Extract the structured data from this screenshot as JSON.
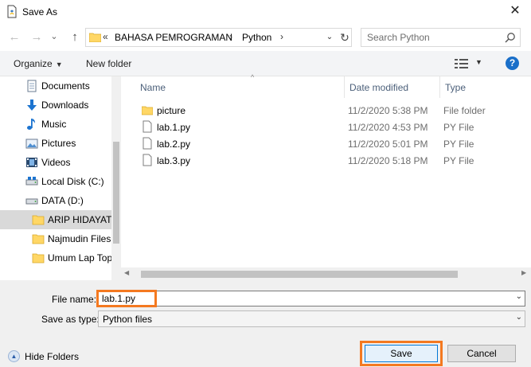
{
  "window": {
    "title": "Save As",
    "close_glyph": "✕"
  },
  "nav": {
    "back_glyph": "←",
    "forward_glyph": "→",
    "recent_glyph": "⌄",
    "up_glyph": "↑"
  },
  "address": {
    "overflow": "«",
    "crumbs": [
      "BAHASA PEMROGRAMAN",
      "Python"
    ],
    "separator": "›",
    "dropdown_glyph": "⌄",
    "refresh_glyph": "↻"
  },
  "search": {
    "placeholder": "Search Python"
  },
  "toolbar": {
    "organize_label": "Organize",
    "organize_caret": "▼",
    "new_folder_label": "New folder",
    "view_caret": "▼",
    "help_label": "?"
  },
  "sidebar": {
    "items": [
      {
        "label": "Documents",
        "icon": "documents-icon"
      },
      {
        "label": "Downloads",
        "icon": "downloads-icon"
      },
      {
        "label": "Music",
        "icon": "music-icon"
      },
      {
        "label": "Pictures",
        "icon": "pictures-icon"
      },
      {
        "label": "Videos",
        "icon": "videos-icon"
      },
      {
        "label": "Local Disk (C:)",
        "icon": "drive-icon"
      },
      {
        "label": "DATA (D:)",
        "icon": "drive-icon"
      },
      {
        "label": "ARIP HIDAYATT",
        "icon": "folder-icon",
        "selected": true
      },
      {
        "label": "Najmudin Files",
        "icon": "folder-icon"
      },
      {
        "label": "Umum Lap Top",
        "icon": "folder-icon"
      }
    ]
  },
  "files": {
    "columns": [
      "Name",
      "Date modified",
      "Type"
    ],
    "sort_glyph": "^",
    "rows": [
      {
        "name": "picture",
        "date": "11/2/2020 5:38 PM",
        "type": "File folder",
        "icon": "folder-icon"
      },
      {
        "name": "lab.1.py",
        "date": "11/2/2020 4:53 PM",
        "type": "PY File",
        "icon": "file-icon"
      },
      {
        "name": "lab.2.py",
        "date": "11/2/2020 5:01 PM",
        "type": "PY File",
        "icon": "file-icon"
      },
      {
        "name": "lab.3.py",
        "date": "11/2/2020 5:18 PM",
        "type": "PY File",
        "icon": "file-icon"
      }
    ],
    "scroll_left_glyph": "◀",
    "scroll_right_glyph": "▶"
  },
  "form": {
    "file_name_label": "File name:",
    "file_name_value": "lab.1.py",
    "save_type_label": "Save as type:",
    "save_type_value": "Python files",
    "dropdown_glyph": "⌄"
  },
  "footer": {
    "hide_folders_label": "Hide Folders",
    "hide_folders_glyph": "▲",
    "save_label": "Save",
    "cancel_label": "Cancel"
  },
  "colors": {
    "highlight": "#f47920",
    "accent": "#0078d7",
    "folder": "#ffd766"
  }
}
